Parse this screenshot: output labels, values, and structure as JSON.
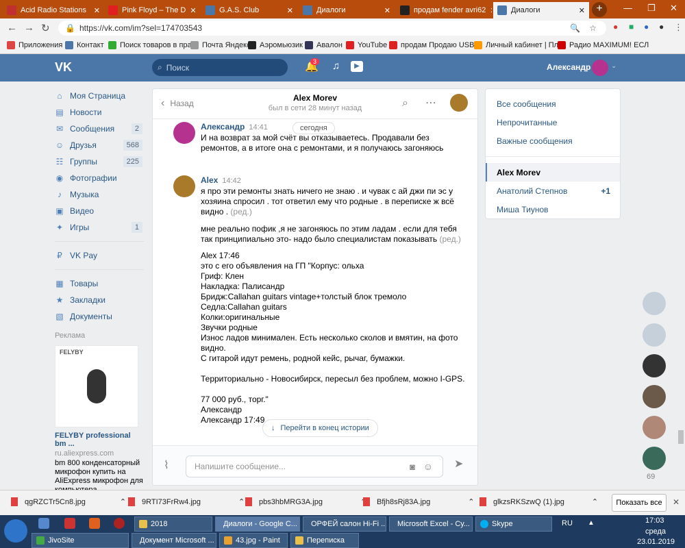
{
  "tabs": [
    {
      "title": "Acid Radio Stations",
      "color": "#c03030"
    },
    {
      "title": "Pink Floyd – The D",
      "color": "#e02020"
    },
    {
      "title": "G.A.S. Club",
      "color": "#4a76a8"
    },
    {
      "title": "Диалоги",
      "color": "#4a76a8"
    },
    {
      "title": "продам fender avri62",
      "color": "#222"
    },
    {
      "title": "Диалоги",
      "color": "#4a76a8"
    }
  ],
  "address": {
    "url": "https://vk.com/im?sel=174703543"
  },
  "bookmarks": [
    "Приложения",
    "Контакт",
    "Поиск товаров в прай",
    "Почта Яндекс",
    "Аэромьюзик",
    "Авалон",
    "YouTube",
    "продам Продаю USB-",
    "Личный кабинет | Пла",
    "Радио MAXIMUM! ЕСЛ"
  ],
  "vk": {
    "logo": "VK",
    "search_placeholder": "Поиск",
    "user": "Александр",
    "notif": "3"
  },
  "menu": [
    {
      "label": "Моя Страница",
      "icon": "home-icon",
      "count": ""
    },
    {
      "label": "Новости",
      "icon": "news-icon",
      "count": ""
    },
    {
      "label": "Сообщения",
      "icon": "messages-icon",
      "count": "2"
    },
    {
      "label": "Друзья",
      "icon": "friends-icon",
      "count": "568"
    },
    {
      "label": "Группы",
      "icon": "groups-icon",
      "count": "225"
    },
    {
      "label": "Фотографии",
      "icon": "photos-icon",
      "count": ""
    },
    {
      "label": "Музыка",
      "icon": "music-icon",
      "count": ""
    },
    {
      "label": "Видео",
      "icon": "video-icon",
      "count": ""
    },
    {
      "label": "Игры",
      "icon": "games-icon",
      "count": "1"
    }
  ],
  "menu2": [
    {
      "label": "VK Pay",
      "icon": "vkpay-icon"
    }
  ],
  "menu3": [
    {
      "label": "Товары",
      "icon": "goods-icon"
    },
    {
      "label": "Закладки",
      "icon": "bookmarks-icon"
    },
    {
      "label": "Документы",
      "icon": "documents-icon"
    }
  ],
  "ad": {
    "heading": "Реклама",
    "title": "FELYBY professional bm ...",
    "domain": "ru.aliexpress.com",
    "text": "bm 800 конденсаторный микрофон купить на AliExpress микрофон для компьютера",
    "brand": "FELYBY"
  },
  "chat": {
    "back": "Назад",
    "name": "Alex Morev",
    "status": "был в сети 28 минут назад",
    "date": "сегодня",
    "m1": {
      "name": "Александр",
      "time": "14:41",
      "text": "И на возврат за мой счёт вы отказываетесь. Продавали без ремонтов, а в итоге она с ремонтами, и я получаюсь загоняюсь"
    },
    "m2": {
      "name": "Alex",
      "time": "14:42",
      "t1": "я про эти ремонты знать ничего не знаю . и чувак с ай джи пи эс у хозяина спросил . тот ответил ему что родные . в переписке ж всё видно .",
      "t2": "мне реально пофик ,я не загоняюсь по этим ладам . если для тебя так принципиально это- надо было специалистам показывать",
      "edited": "(ред.)",
      "lines": [
        "Alex 17:46",
        "это с его объявления на ГП \"Корпус: ольха",
        "Гриф: Клен",
        "Накладка: Палисандр",
        "Бридж:Callahan guitars vintage+толстый блок тремоло",
        "Седла:Callahan guitars",
        "Колки:оригинальные",
        "Звучки родные",
        "Износ ладов минимален. Есть несколько сколов и вмятин, на фото видно.",
        "С гитарой идут ремень, родной кейс, рычаг, бумажки.",
        "",
        "Территориально - Новосибирск, пересыл без проблем, можно I-GPS.",
        "",
        "77 000 руб., торг.\"",
        "Александр",
        "Александр 17:49"
      ]
    },
    "jump": "Перейти в конец истории",
    "input_placeholder": "Напишите сообщение..."
  },
  "right": {
    "items": [
      "Все сообщения",
      "Непрочитанные",
      "Важные сообщения"
    ],
    "convs": [
      {
        "name": "Alex Morev",
        "badge": ""
      },
      {
        "name": "Анатолий Степнов",
        "badge": "+1"
      },
      {
        "name": "Миша Тиунов",
        "badge": ""
      }
    ],
    "friends_count": "69"
  },
  "downloads": [
    "qgRZCTr5Cn8.jpg",
    "9RTI73FrRw4.jpg",
    "pbs3hbMRG3A.jpg",
    "Bfjh8sRj83A.jpg",
    "glkzsRKSzwQ (1).jpg"
  ],
  "show_all": "Показать все",
  "taskbar": {
    "row1": [
      "2018",
      "Диалоги - Google C...",
      "ОРФЕЙ салон Hi-Fi ...",
      "Microsoft Excel - Су...",
      "Skype"
    ],
    "row2": [
      "JivoSite",
      "Документ Microsoft ...",
      "43.jpg - Paint",
      "Переписка"
    ],
    "lang": "RU",
    "time": "17:03",
    "day": "среда",
    "date": "23.01.2019"
  }
}
